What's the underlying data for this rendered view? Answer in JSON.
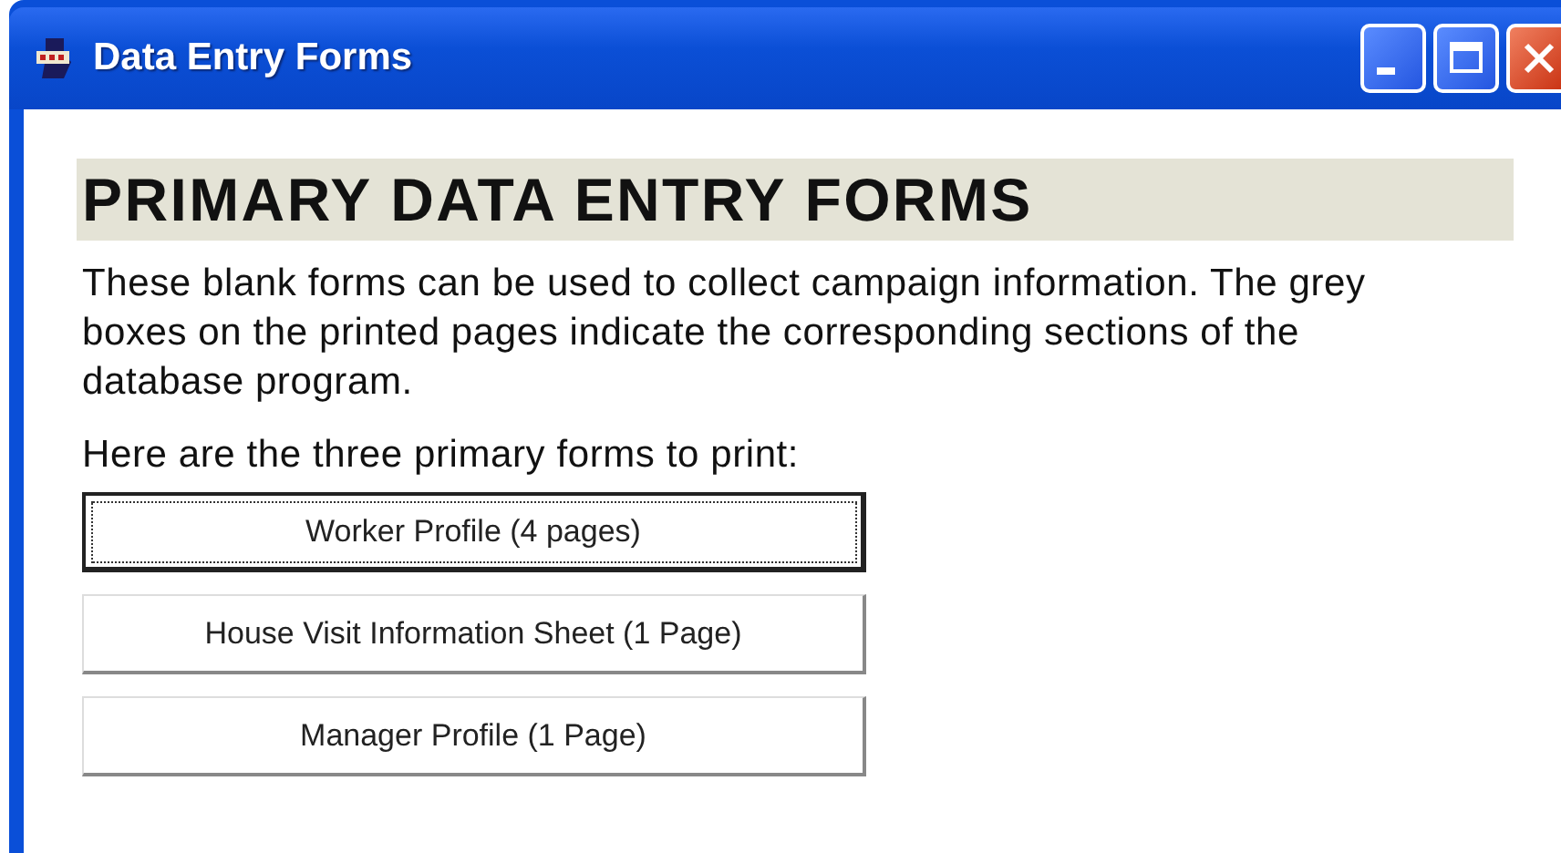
{
  "window": {
    "title": "Data Entry Forms"
  },
  "heading": "PRIMARY DATA ENTRY FORMS",
  "description": "These blank forms can be used to collect campaign information. The grey boxes on the printed pages indicate the corresponding sections of the database program.",
  "prompt": "Here are the three primary forms to print:",
  "buttons": [
    {
      "label": "Worker Profile (4 pages)",
      "focused": true
    },
    {
      "label": "House Visit Information Sheet (1 Page)",
      "focused": false
    },
    {
      "label": "Manager Profile (1 Page)",
      "focused": false
    }
  ]
}
